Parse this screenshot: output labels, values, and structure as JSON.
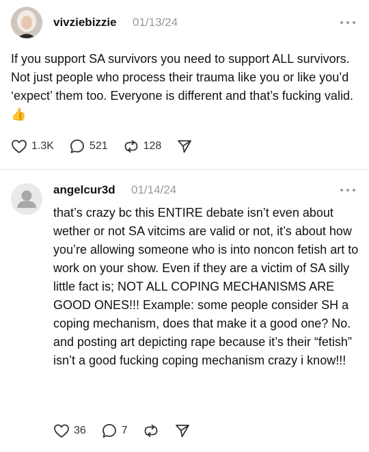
{
  "posts": [
    {
      "username": "vivziebizzie",
      "date": "01/13/24",
      "text": "If you support SA survivors you need to support ALL survivors. Not just people who process their trauma like you or like you’d ‘expect’ them too. Everyone is different and that’s fucking valid. 👍",
      "likes": "1.3K",
      "replies": "521",
      "reposts": "128"
    },
    {
      "username": "angelcur3d",
      "date": "01/14/24",
      "text": "that’s crazy bc this ENTIRE debate isn’t even about wether or not SA vitcims are valid or not, it’s about how you’re allowing someone who is into noncon fetish art to work on your show. Even if they are a victim of SA silly little fact is; NOT ALL COPING MECHANISMS ARE GOOD ONES!!! Example: some people consider SH a coping mechanism, does that make it a good one? No. and posting art depicting rape because it’s their “fetish” isn’t a good fucking coping mechanism crazy i know!!!",
      "likes": "36",
      "replies": "7",
      "reposts": ""
    }
  ],
  "icons": [
    "heart-icon",
    "comment-icon",
    "repost-icon",
    "share-icon",
    "more-icon"
  ]
}
